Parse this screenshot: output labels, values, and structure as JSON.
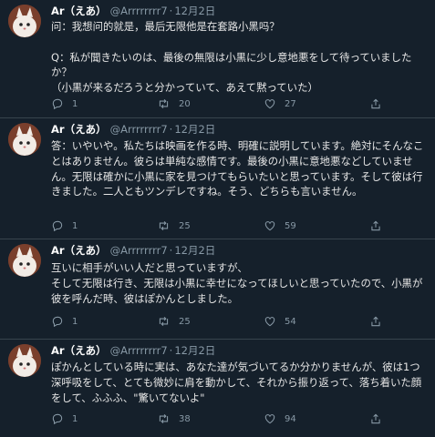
{
  "tweets": [
    {
      "name": "Ar（えあ）",
      "handle": "@Arrrrrrrr7",
      "sep": "·",
      "date": "12月2日",
      "text": "问：我想问的就是，最后无限他是在套路小黑吗？\n\nQ：私が聞きたいのは、最後の無限は小黒に少し意地悪をして待っていましたか？\n（小黒が来るだろうと分かっていて、あえて黙っていた）",
      "replies": "1",
      "retweets": "20",
      "likes": "27"
    },
    {
      "name": "Ar（えあ）",
      "handle": "@Arrrrrrrr7",
      "sep": "·",
      "date": "12月2日",
      "text": "答：いやいや。私たちは映画を作る時、明確に説明しています。絶対にそんなことはありません。彼らは単純な感情です。最後の小黒に意地悪などしていません。无限は確かに小黒に家を見つけてもらいたいと思っています。そして彼は行きました。二人ともツンデレですね。そう、どちらも言いません。",
      "replies": "1",
      "retweets": "25",
      "likes": "59"
    },
    {
      "name": "Ar（えあ）",
      "handle": "@Arrrrrrrr7",
      "sep": "·",
      "date": "12月2日",
      "text": "互いに相手がいい人だと思っていますが、\nそして无限は行き、无限は小黒に幸せになってほしいと思っていたので、小黒が彼を呼んだ時、彼はぽかんとしました。",
      "replies": "1",
      "retweets": "25",
      "likes": "54"
    },
    {
      "name": "Ar（えあ）",
      "handle": "@Arrrrrrrr7",
      "sep": "·",
      "date": "12月2日",
      "text": "ぽかんとしている時に実は、あなた達が気づいてるか分かりませんが、彼は1つ深呼吸をして、とても微妙に肩を動かして、それから振り返って、落ち着いた顔をして、ふふふ、\"驚いてないよ\"",
      "replies": "1",
      "retweets": "38",
      "likes": "94"
    }
  ]
}
